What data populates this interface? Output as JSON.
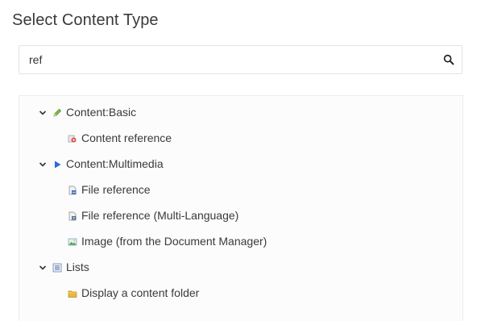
{
  "dialog": {
    "title": "Select Content Type"
  },
  "search": {
    "value": "ref",
    "icon": "search-icon"
  },
  "tree": {
    "groups": [
      {
        "label": "Content:Basic",
        "expanded": true,
        "icon": "pencil-icon",
        "items": [
          {
            "label": "Content reference",
            "icon": "content-reference-icon"
          }
        ]
      },
      {
        "label": "Content:Multimedia",
        "expanded": true,
        "icon": "play-icon",
        "items": [
          {
            "label": "File reference",
            "icon": "file-reference-icon"
          },
          {
            "label": "File reference (Multi-Language)",
            "icon": "file-reference-multilanguage-icon"
          },
          {
            "label": "Image (from the Document Manager)",
            "icon": "image-icon"
          }
        ]
      },
      {
        "label": "Lists",
        "expanded": true,
        "icon": "list-icon",
        "items": [
          {
            "label": "Display a content folder",
            "icon": "folder-icon"
          }
        ]
      }
    ]
  },
  "colors": {
    "text": "#3a3a3a",
    "border": "#e3e3e3",
    "panel_background": "#fcfcfc",
    "play_icon": "#2b6cd8",
    "pencil_icon": "#6cbf3a",
    "folder_icon": "#e8b83a"
  }
}
